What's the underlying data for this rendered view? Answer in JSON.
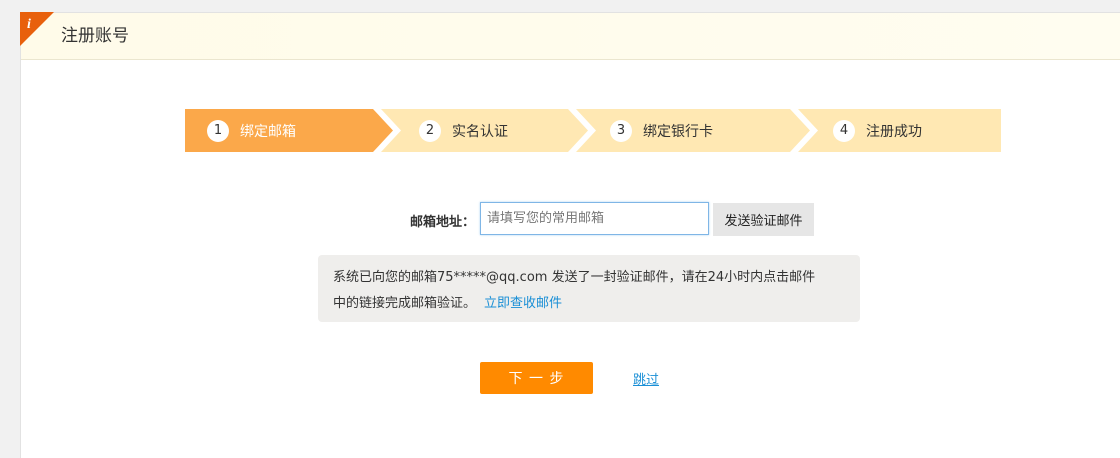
{
  "header": {
    "title": "注册账号",
    "badge_icon": "info-icon",
    "badge_glyph": "i",
    "badge_color": "#e8600c"
  },
  "steps": [
    {
      "number": "1",
      "label": "绑定邮箱",
      "active": true
    },
    {
      "number": "2",
      "label": "实名认证",
      "active": false
    },
    {
      "number": "3",
      "label": "绑定银行卡",
      "active": false
    },
    {
      "number": "4",
      "label": "注册成功",
      "active": false
    }
  ],
  "colors": {
    "step_active": "#fba84a",
    "step_inactive": "#ffe8b3",
    "primary_button": "#ff8a00",
    "link": "#1a8fd6"
  },
  "form": {
    "email_label": "邮箱地址：",
    "email_value": "",
    "email_placeholder": "请填写您的常用邮箱",
    "send_button": "发送验证邮件"
  },
  "notice": {
    "line1": "系统已向您的邮箱75*****@qq.com 发送了一封验证邮件，请在24小时内点击邮件",
    "line2": "中的链接完成邮箱验证。",
    "link_text": "立即查收邮件"
  },
  "actions": {
    "next_button": "下 一 步",
    "skip_link": "跳过"
  }
}
